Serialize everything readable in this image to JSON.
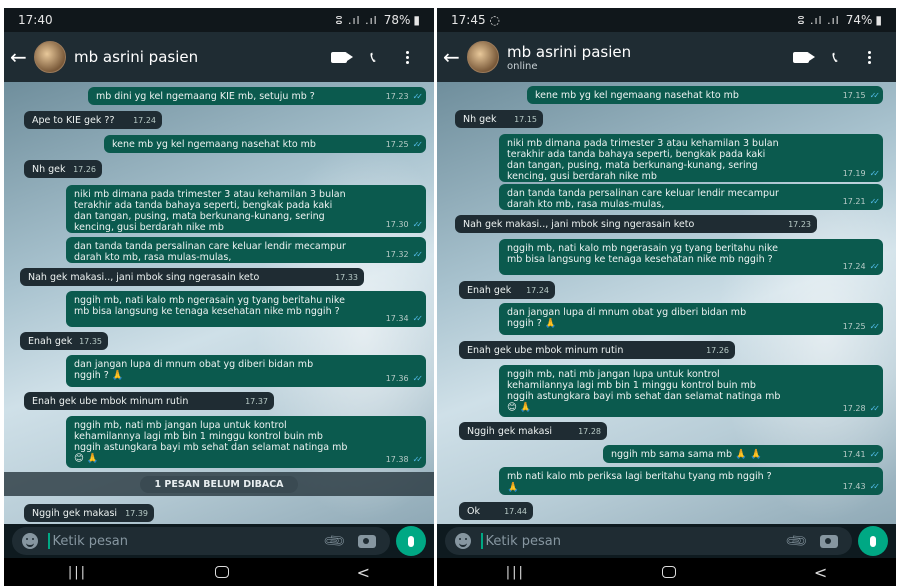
{
  "left": {
    "status": {
      "time": "17:40",
      "signal": "ⵓ .ıl .ıl",
      "battery": "78%"
    },
    "header": {
      "name": "mb asrini pasien",
      "subtitle": ""
    },
    "messages": [
      {
        "text": "mb dini yg kel ngemaang KIE mb, setuju mb ?",
        "time": "17.23"
      },
      {
        "text": "Ape to KIE gek ??",
        "time": "17.24"
      },
      {
        "text": "kene mb yg kel ngemaang nasehat kto mb",
        "time": "17.25"
      },
      {
        "text": "Nh gek",
        "time": "17.26"
      },
      {
        "text": "niki mb dimana pada trimester 3 atau kehamilan 3 bulan\nterakhir ada tanda bahaya seperti, bengkak pada kaki\ndan tangan, pusing, mata berkunang-kunang, sering\nkencing,  gusi berdarah nike mb",
        "time": "17.30"
      },
      {
        "text": "dan tanda tanda persalinan care keluar lendir mecampur\ndarah kto mb, rasa mulas-mulas,",
        "time": "17.32"
      },
      {
        "text": "Nah gek makasi.., jani mbok sing ngerasain keto",
        "time": "17.33"
      },
      {
        "text": "nggih mb, nati kalo mb ngerasain yg tyang beritahu nike\nmb bisa langsung ke tenaga kesehatan nike mb nggih ?",
        "time": "17.34"
      },
      {
        "text": "Enah gek",
        "time": "17.35"
      },
      {
        "text": "dan jangan lupa di mnum obat yg diberi bidan mb\nnggih ? 🙏",
        "time": "17.36"
      },
      {
        "text": "Enah gek ube mbok minum rutin",
        "time": "17.37"
      },
      {
        "text": "nggih mb, nati mb jangan lupa untuk kontrol\nkehamilannya lagi mb bin 1 minggu kontrol buin mb\nnggih astungkara bayi mb sehat dan selamat natinga mb\n😊 🙏",
        "time": "17.38"
      },
      {
        "text": "Nggih gek makasi",
        "time": "17.39"
      }
    ],
    "unread_banner": "1 PESAN BELUM DIBACA",
    "input_placeholder": "Ketik pesan"
  },
  "right": {
    "status": {
      "time": "17:45",
      "signal": "ⵓ .ıl .ıl",
      "battery": "74%"
    },
    "header": {
      "name": "mb asrini pasien",
      "subtitle": "online"
    },
    "messages": [
      {
        "text": "kene mb yg kel ngemaang nasehat kto mb",
        "time": "17.15"
      },
      {
        "text": "Nh gek",
        "time": "17.15"
      },
      {
        "text": "niki mb dimana pada trimester 3 atau kehamilan 3 bulan\nterakhir ada tanda bahaya seperti, bengkak pada kaki\ndan tangan, pusing, mata berkunang-kunang, sering\nkencing,  gusi berdarah nike mb",
        "time": "17.19"
      },
      {
        "text": "dan tanda tanda persalinan care keluar lendir mecampur\ndarah kto mb, rasa mulas-mulas,",
        "time": "17.21"
      },
      {
        "text": "Nah gek makasi.., jani mbok sing ngerasain keto",
        "time": "17.23"
      },
      {
        "text": "nggih mb, nati kalo mb ngerasain yg tyang beritahu nike\nmb bisa langsung ke tenaga kesehatan nike mb nggih ?",
        "time": "17.24"
      },
      {
        "text": "Enah gek",
        "time": "17.24"
      },
      {
        "text": "dan jangan lupa di mnum obat yg diberi bidan mb\nnggih ? 🙏",
        "time": "17.25"
      },
      {
        "text": "Enah gek ube mbok minum rutin",
        "time": "17.26"
      },
      {
        "text": "nggih mb, nati mb jangan lupa untuk kontrol\nkehamilannya lagi mb bin 1 minggu kontrol buin mb\nnggih astungkara bayi mb sehat dan selamat natinga mb\n😊 🙏",
        "time": "17.28"
      },
      {
        "text": "Nggih gek makasi",
        "time": "17.28"
      },
      {
        "text": "nggih mb sama sama mb 🙏 🙏",
        "time": "17.41"
      },
      {
        "text": "mb nati kalo mb periksa lagi beritahu tyang mb nggih ?\n🙏",
        "time": "17.43"
      },
      {
        "text": "Ok",
        "time": "17.44"
      }
    ],
    "input_placeholder": "Ketik pesan"
  }
}
